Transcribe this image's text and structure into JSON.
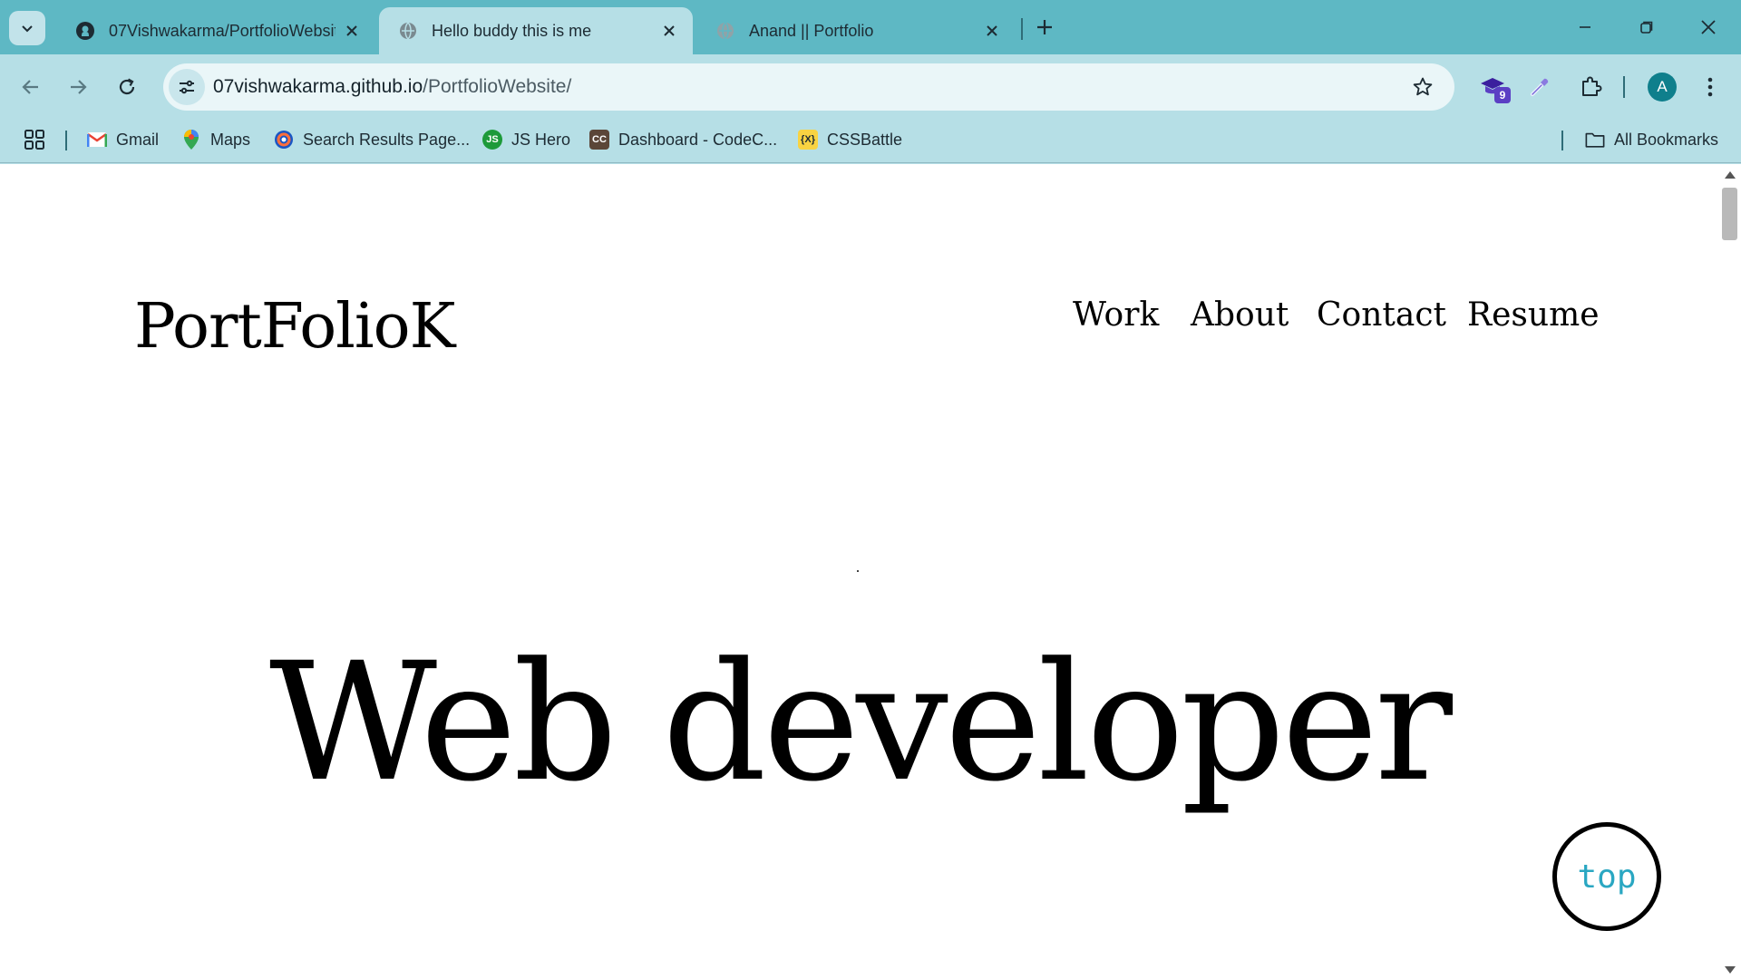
{
  "browser": {
    "tabs": [
      {
        "title": "07Vishwakarma/PortfolioWebsite",
        "icon": "github-icon",
        "active": false
      },
      {
        "title": "Hello buddy this is me",
        "icon": "globe-icon",
        "active": true
      },
      {
        "title": "Anand || Portfolio",
        "icon": "globe-icon",
        "active": false
      }
    ],
    "url": {
      "host": "07vishwakarma.github.io",
      "path": "/PortfolioWebsite/"
    },
    "extension_badge": "9",
    "profile_initial": "A",
    "bookmarks": [
      {
        "label": "Gmail",
        "icon": "gmail-icon"
      },
      {
        "label": "Maps",
        "icon": "maps-icon"
      },
      {
        "label": "Search Results Page...",
        "icon": "search-results-icon"
      },
      {
        "label": "JS Hero",
        "icon": "js-hero-icon",
        "icon_text": "JS"
      },
      {
        "label": "Dashboard - CodeC...",
        "icon": "codechef-icon",
        "icon_text": "CC"
      },
      {
        "label": "CSSBattle",
        "icon": "cssbattle-icon",
        "icon_text": "{X}"
      }
    ],
    "all_bookmarks_label": "All Bookmarks",
    "colors": {
      "frame": "#5eb8c4",
      "toolbar": "#b6dfe6",
      "accent": "#2aa7c2"
    }
  },
  "page": {
    "logo": "PortFolioK",
    "nav": [
      "Work",
      "About",
      "Contact",
      "Resume"
    ],
    "hero_title": "Web developer",
    "top_button": "top"
  }
}
